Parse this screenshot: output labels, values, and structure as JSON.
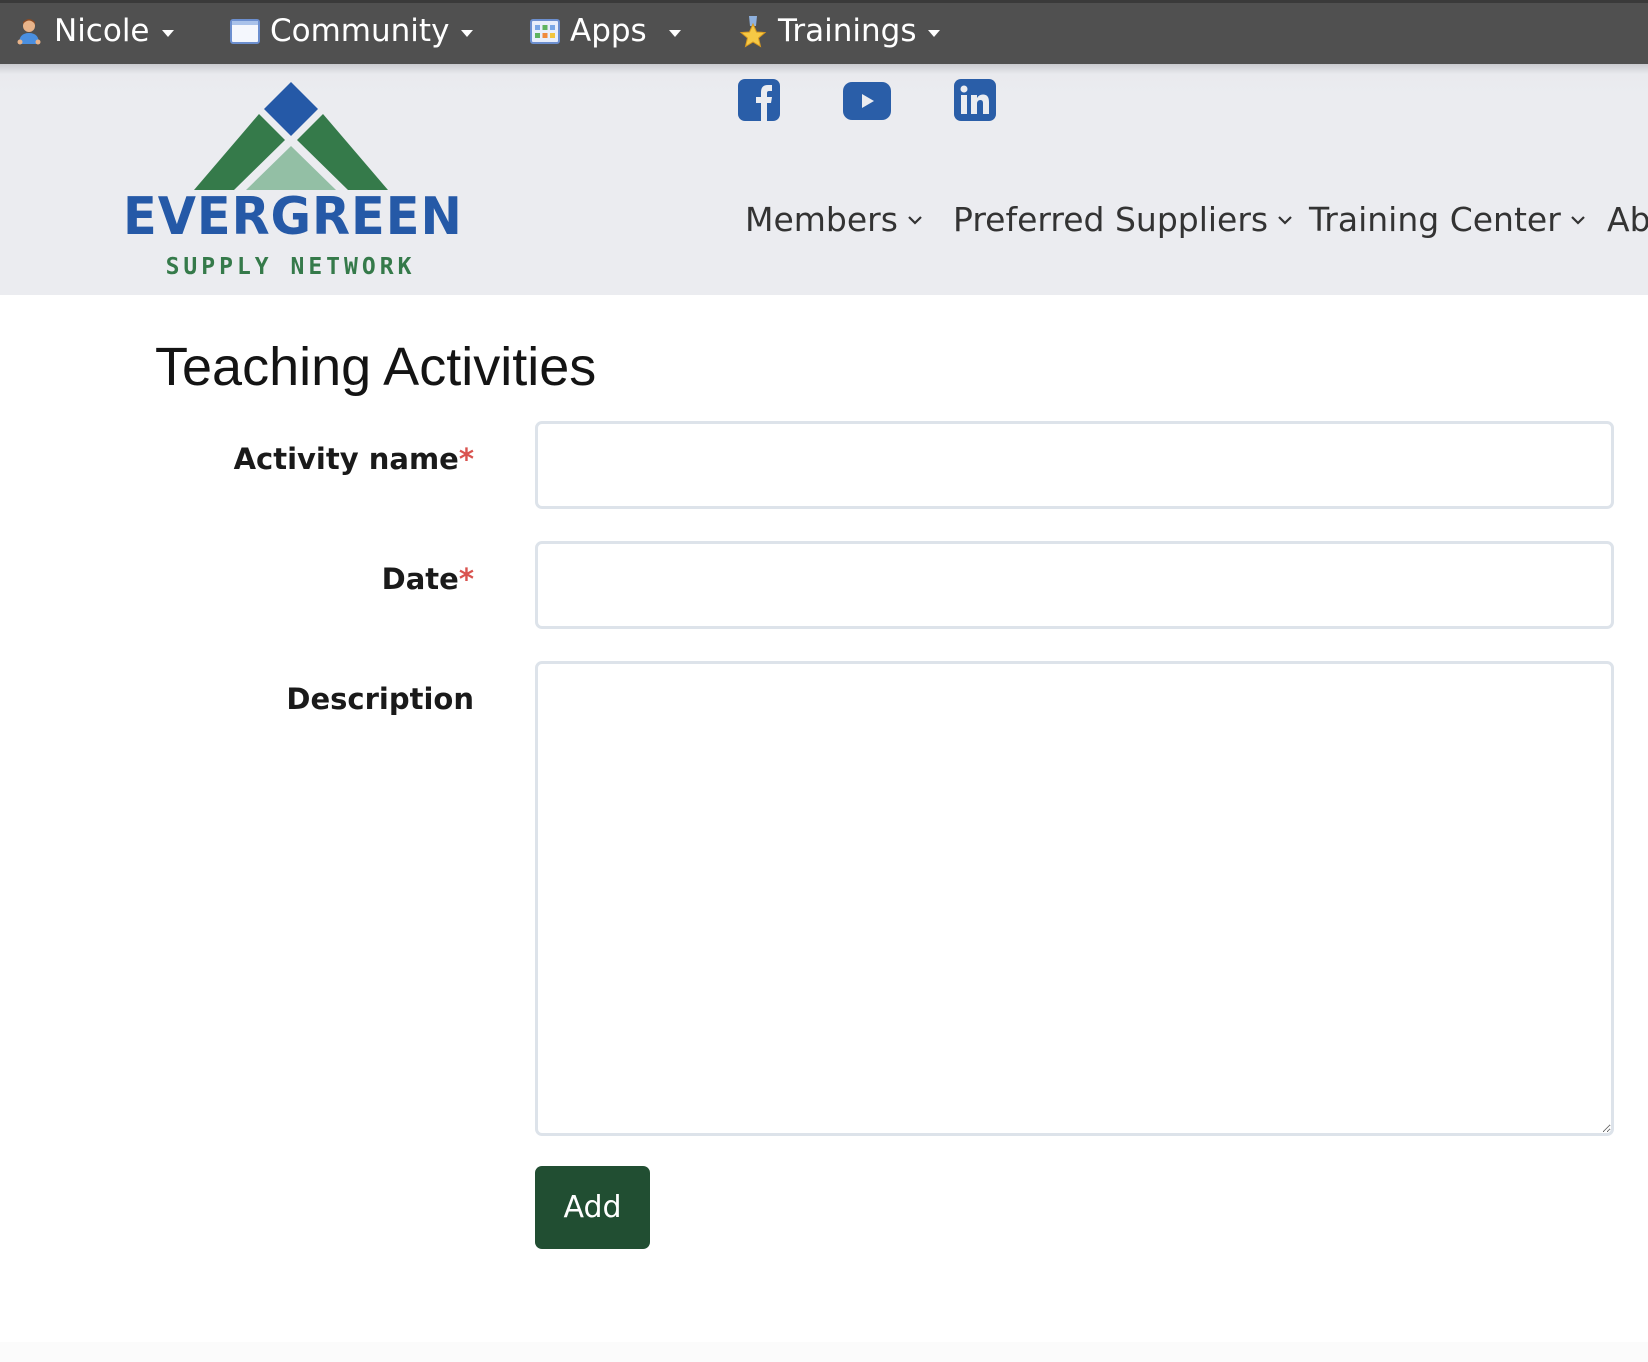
{
  "topbar": {
    "items": [
      {
        "label": "Nicole",
        "icon": "user-avatar-icon"
      },
      {
        "label": "Community",
        "icon": "window-icon"
      },
      {
        "label": "Apps",
        "icon": "apps-grid-icon"
      },
      {
        "label": "Trainings",
        "icon": "medal-star-icon"
      }
    ]
  },
  "header": {
    "logo": {
      "name": "EVERGREEN",
      "tagline": "SUPPLY NETWORK"
    },
    "social": [
      {
        "name": "facebook-icon",
        "label": "Facebook"
      },
      {
        "name": "youtube-icon",
        "label": "YouTube"
      },
      {
        "name": "linkedin-icon",
        "label": "LinkedIn"
      }
    ],
    "nav": [
      {
        "label": "Members"
      },
      {
        "label": "Preferred Suppliers"
      },
      {
        "label": "Training Center"
      },
      {
        "label": "Ab"
      }
    ]
  },
  "main": {
    "title": "Teaching Activities",
    "form": {
      "activity_name": {
        "label": "Activity name",
        "required": "*",
        "value": "",
        "placeholder": ""
      },
      "date": {
        "label": "Date",
        "required": "*",
        "value": "",
        "placeholder": ""
      },
      "description": {
        "label": "Description",
        "value": "",
        "placeholder": ""
      },
      "submit_label": "Add"
    }
  },
  "colors": {
    "topbar": "#505050",
    "header_bg": "#ebecf0",
    "brand_blue": "#2559a7",
    "brand_green": "#357a4a",
    "button_green": "#214e32",
    "required": "#d9534f"
  }
}
